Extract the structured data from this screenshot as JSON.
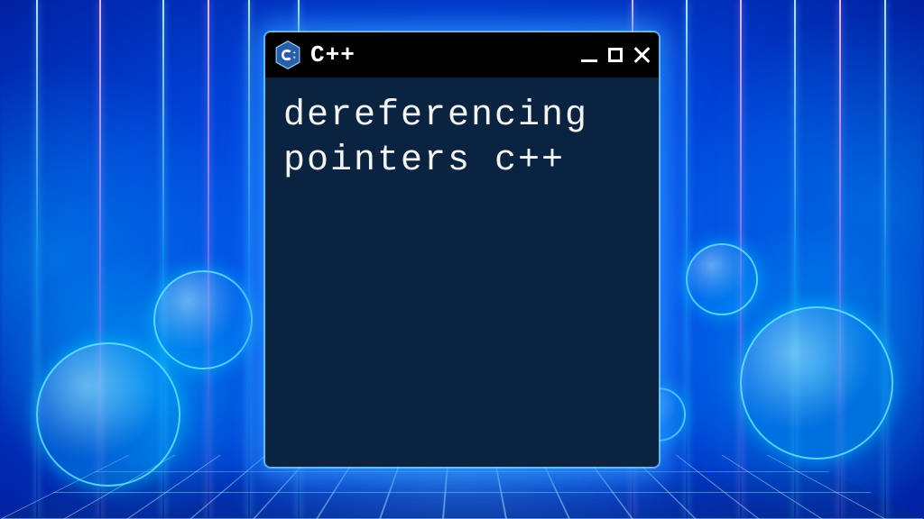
{
  "titlebar": {
    "language_label": "C++",
    "icon_name": "cpp-hexagon-icon"
  },
  "window_controls": {
    "minimize": "minimize",
    "maximize": "maximize",
    "close": "close"
  },
  "content": {
    "text": "dereferencing pointers c++"
  },
  "colors": {
    "window_bg": "#0a2341",
    "titlebar_bg": "#000000",
    "text": "#f3f3f0",
    "glow": "#3caaff"
  }
}
